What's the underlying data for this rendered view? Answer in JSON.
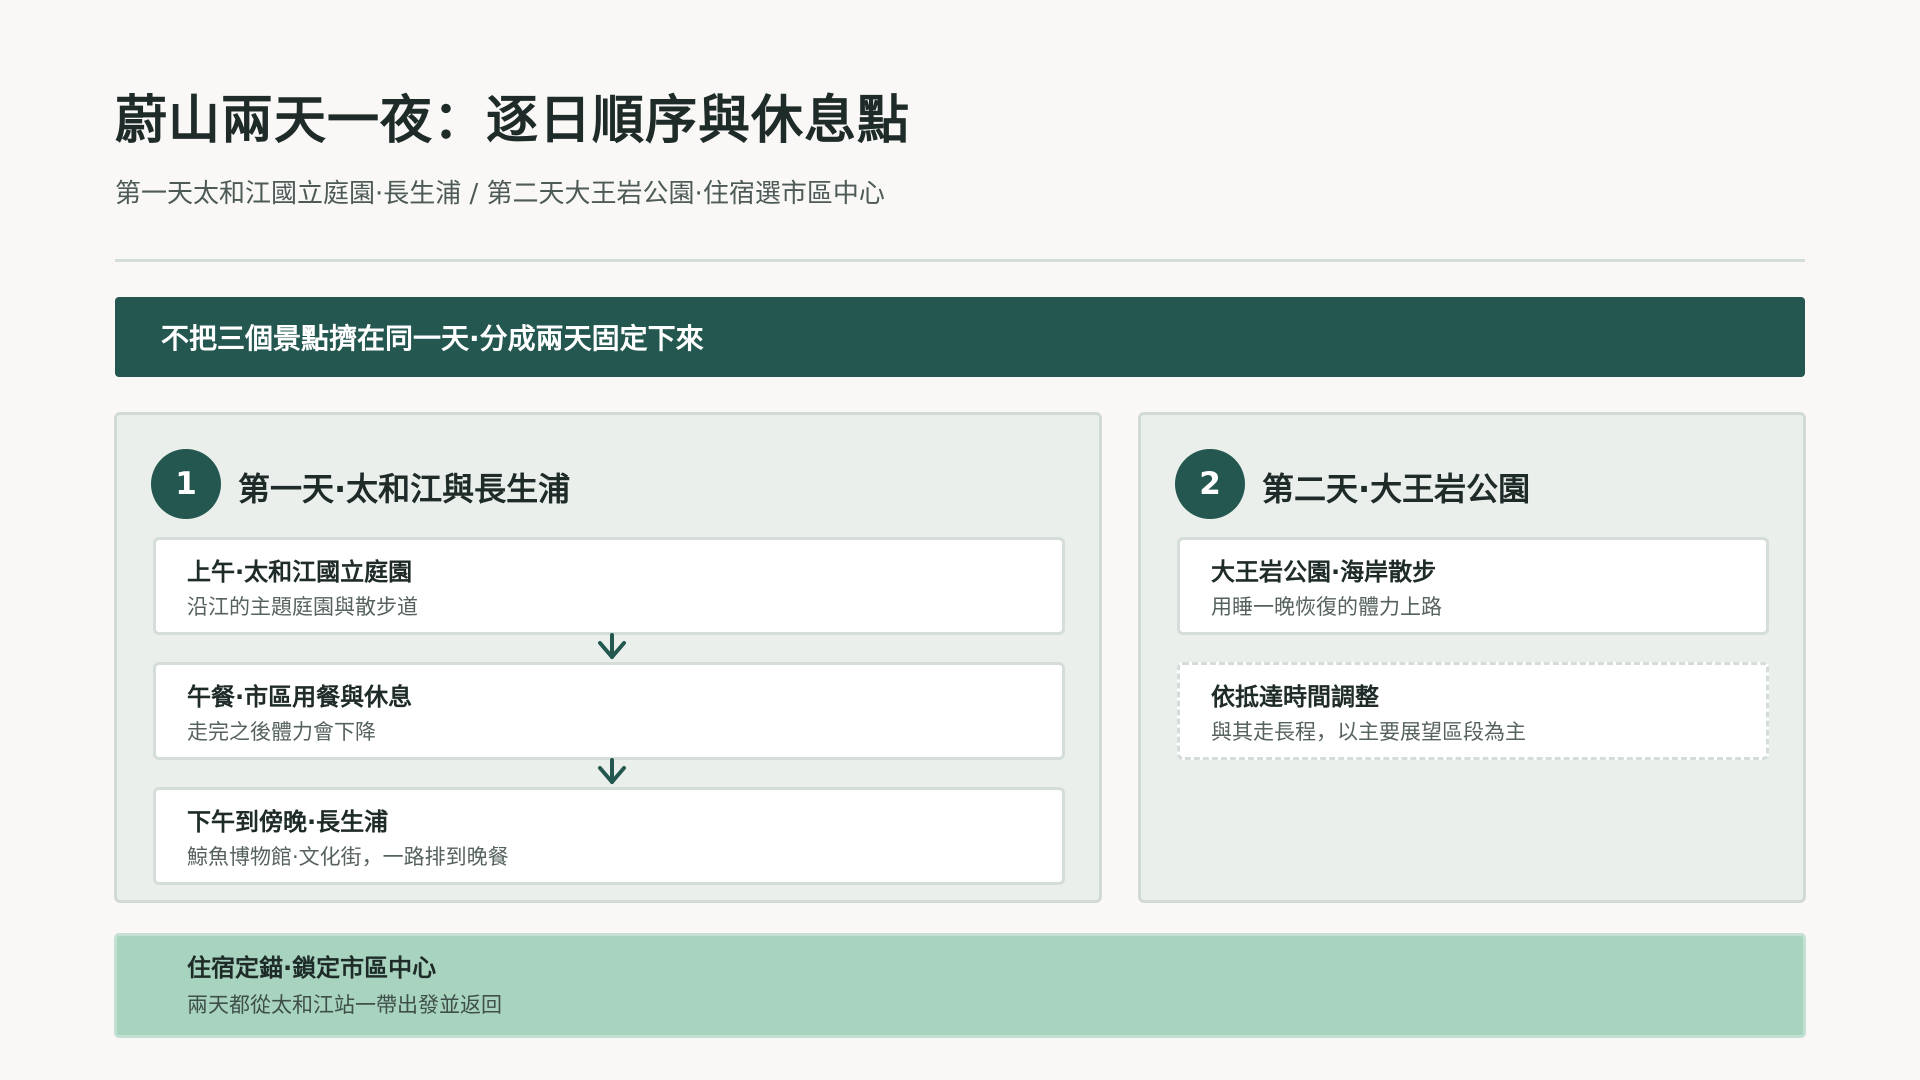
{
  "page": {
    "title": "蔚山兩天一夜：逐日順序與休息點",
    "subtitle": "第一天太和江國立庭園·長生浦 / 第二天大王岩公園·住宿選市區中心"
  },
  "banner": {
    "text": "不把三個景點擠在同一天·分成兩天固定下來"
  },
  "day1": {
    "number": "1",
    "title": "第一天·太和江與長生浦",
    "steps": [
      {
        "title": "上午·太和江國立庭園",
        "desc": "沿江的主題庭園與散步道"
      },
      {
        "title": "午餐·市區用餐與休息",
        "desc": "走完之後體力會下降"
      },
      {
        "title": "下午到傍晚·長生浦",
        "desc": "鯨魚博物館·文化街，一路排到晚餐"
      }
    ]
  },
  "day2": {
    "number": "2",
    "title": "第二天·大王岩公園",
    "steps": [
      {
        "title": "大王岩公園·海岸散步",
        "desc": "用睡一晚恢復的體力上路"
      },
      {
        "title": "依抵達時間調整",
        "desc": "與其走長程，以主要展望區段為主"
      }
    ]
  },
  "lodging": {
    "title": "住宿定錨·鎖定市區中心",
    "desc": "兩天都從太和江站一帶出發並返回"
  },
  "colors": {
    "background": "#f9f8f6",
    "accent": "#235750",
    "panel": "#ebefec",
    "lodging": "#a8d4bf"
  },
  "icons": {
    "flow_arrow": "chevron-down-arrow"
  }
}
